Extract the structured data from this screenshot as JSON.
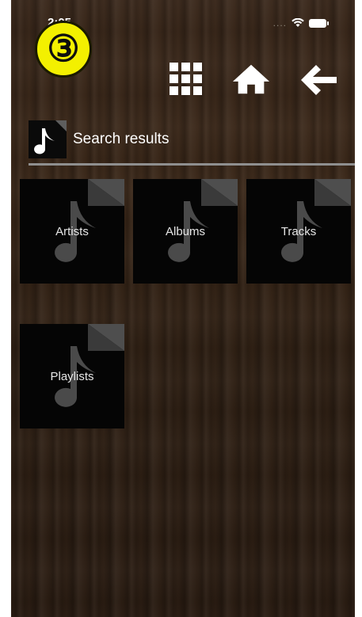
{
  "status_bar": {
    "time": "2:05",
    "signal_icon": "cellular-dots-icon",
    "wifi_icon": "wifi-icon",
    "battery_icon": "battery-icon"
  },
  "step_badge": "③",
  "toolbar": {
    "grid_icon": "grid-icon",
    "home_icon": "home-icon",
    "back_icon": "back-arrow-icon"
  },
  "header": {
    "icon": "music-note-icon",
    "title": "Search results"
  },
  "categories": [
    {
      "label": "Artists",
      "icon": "music-file-icon"
    },
    {
      "label": "Albums",
      "icon": "music-file-icon"
    },
    {
      "label": "Tracks",
      "icon": "music-file-icon"
    },
    {
      "label": "Playlists",
      "icon": "music-file-icon"
    }
  ],
  "colors": {
    "badge_yellow": "#f3f000",
    "tile_background": "#050505",
    "icon_gray": "#5a5a5a"
  }
}
